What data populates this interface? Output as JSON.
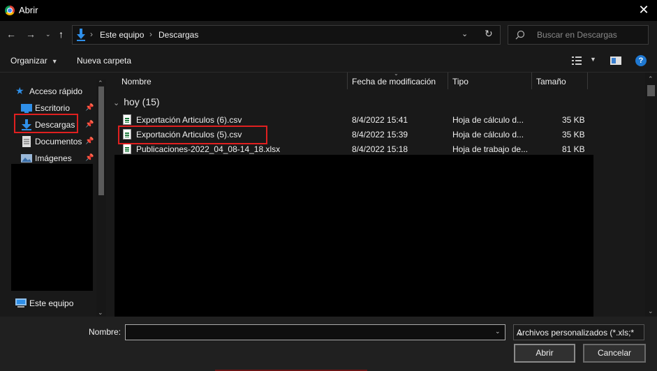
{
  "window": {
    "title": "Abrir"
  },
  "address": {
    "crumbs": [
      "Este equipo",
      "Descargas"
    ],
    "search_placeholder": "Buscar en Descargas"
  },
  "toolbar": {
    "organize": "Organizar",
    "new_folder": "Nueva carpeta"
  },
  "nav": {
    "quick_access": "Acceso rápido",
    "items": [
      {
        "label": "Escritorio",
        "icon": "desktop-icon",
        "pinned": true
      },
      {
        "label": "Descargas",
        "icon": "downloads-icon",
        "pinned": true
      },
      {
        "label": "Documentos",
        "icon": "documents-icon",
        "pinned": true
      },
      {
        "label": "Imágenes",
        "icon": "pictures-icon",
        "pinned": true
      }
    ],
    "this_pc": "Este equipo"
  },
  "columns": {
    "name": "Nombre",
    "date": "Fecha de modificación",
    "type": "Tipo",
    "size": "Tamaño"
  },
  "group": {
    "label": "hoy (15)"
  },
  "files": [
    {
      "name": "Exportación Articulos (6).csv",
      "date": "8/4/2022 15:41",
      "type": "Hoja de cálculo d...",
      "size": "35 KB"
    },
    {
      "name": "Exportación Articulos (5).csv",
      "date": "8/4/2022 15:39",
      "type": "Hoja de cálculo d...",
      "size": "35 KB"
    },
    {
      "name": "Publicaciones-2022_04_08-14_18.xlsx",
      "date": "8/4/2022 15:18",
      "type": "Hoja de trabajo de...",
      "size": "81 KB"
    }
  ],
  "bottom": {
    "name_label": "Nombre:",
    "name_value": "",
    "filter": "Archivos personalizados (*.xls;*",
    "open_button": "Abrir",
    "cancel_button": "Cancelar"
  },
  "colors": {
    "highlight": "#e02020",
    "accent": "#1f78d1"
  }
}
